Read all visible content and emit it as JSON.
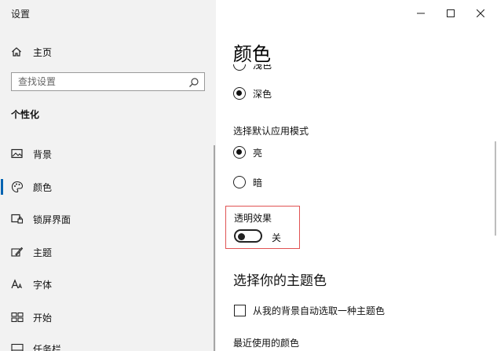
{
  "window": {
    "title": "设置",
    "minimize": "minimize-icon",
    "maximize": "maximize-icon",
    "close": "close-icon"
  },
  "sidebar": {
    "home_label": "主页",
    "search_placeholder": "查找设置",
    "section_title": "个性化",
    "items": [
      {
        "label": "背景",
        "icon": "picture-icon"
      },
      {
        "label": "颜色",
        "icon": "palette-icon",
        "selected": true
      },
      {
        "label": "锁屏界面",
        "icon": "lock-screen-icon"
      },
      {
        "label": "主题",
        "icon": "theme-brush-icon"
      },
      {
        "label": "字体",
        "icon": "font-icon"
      },
      {
        "label": "开始",
        "icon": "start-grid-icon"
      },
      {
        "label": "任务栏",
        "icon": "taskbar-icon"
      }
    ]
  },
  "main": {
    "title": "颜色",
    "partial_option": "浅色",
    "mode_dark_label": "深色",
    "default_app_mode_label": "选择默认应用模式",
    "app_mode_options": [
      {
        "label": "亮",
        "selected": true
      },
      {
        "label": "暗",
        "selected": false
      }
    ],
    "transparency": {
      "label": "透明效果",
      "state": "关",
      "on": false
    },
    "accent_heading": "选择你的主题色",
    "auto_accent_label": "从我的背景自动选取一种主题色",
    "recent_colors_label": "最近使用的颜色"
  },
  "colors": {
    "sidebar_bg": "#f2f2f2",
    "accent": "#0063b1",
    "highlight_border": "#e05353"
  }
}
